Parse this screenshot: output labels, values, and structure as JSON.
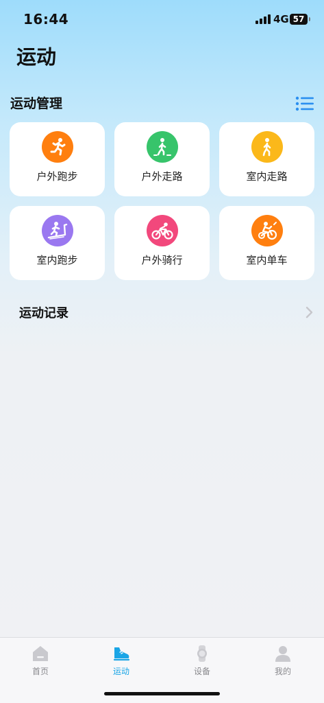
{
  "status_bar": {
    "time": "16:44",
    "network": "4G",
    "battery": "57"
  },
  "page": {
    "title": "运动"
  },
  "management": {
    "title": "运动管理",
    "items": [
      {
        "label": "户外跑步",
        "icon": "outdoor-run-icon",
        "color": "#ff7f0f"
      },
      {
        "label": "户外走路",
        "icon": "outdoor-walk-icon",
        "color": "#37c46b"
      },
      {
        "label": "室内走路",
        "icon": "indoor-walk-icon",
        "color": "#fbb81a"
      },
      {
        "label": "室内跑步",
        "icon": "treadmill-icon",
        "color": "#9a78f0"
      },
      {
        "label": "户外骑行",
        "icon": "outdoor-cycling-icon",
        "color": "#f2487c"
      },
      {
        "label": "室内单车",
        "icon": "indoor-bike-icon",
        "color": "#ff7f0f"
      }
    ]
  },
  "records": {
    "label": "运动记录"
  },
  "tabbar": {
    "items": [
      {
        "label": "首页",
        "icon": "home-icon"
      },
      {
        "label": "运动",
        "icon": "shoe-icon",
        "active": true
      },
      {
        "label": "设备",
        "icon": "watch-icon"
      },
      {
        "label": "我的",
        "icon": "person-icon"
      }
    ]
  },
  "colors": {
    "accent": "#1aa5e6",
    "list_icon": "#2a8ff0"
  }
}
